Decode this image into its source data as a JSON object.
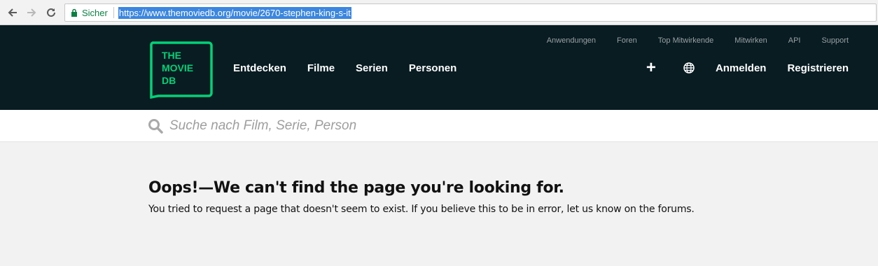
{
  "browser": {
    "security_label": "Sicher",
    "url": "https://www.themoviedb.org/movie/2670-stephen-king-s-it"
  },
  "header": {
    "logo_lines": [
      "THE",
      "MOVIE",
      "DB"
    ],
    "main_nav": [
      "Entdecken",
      "Filme",
      "Serien",
      "Personen"
    ],
    "sub_nav": [
      "Anwendungen",
      "Foren",
      "Top Mitwirkende",
      "Mitwirken",
      "API",
      "Support"
    ],
    "plus_label": "+",
    "login_label": "Anmelden",
    "register_label": "Registrieren"
  },
  "search": {
    "placeholder": "Suche nach Film, Serie, Person"
  },
  "error": {
    "title": "Oops!—We can't find the page you're looking for.",
    "message": "You tried to request a page that doesn't seem to exist. If you believe this to be in error, let us know on the forums."
  },
  "colors": {
    "header_bg": "#081c22",
    "logo_green": "#01d277",
    "page_bg": "#f2f2f2"
  }
}
